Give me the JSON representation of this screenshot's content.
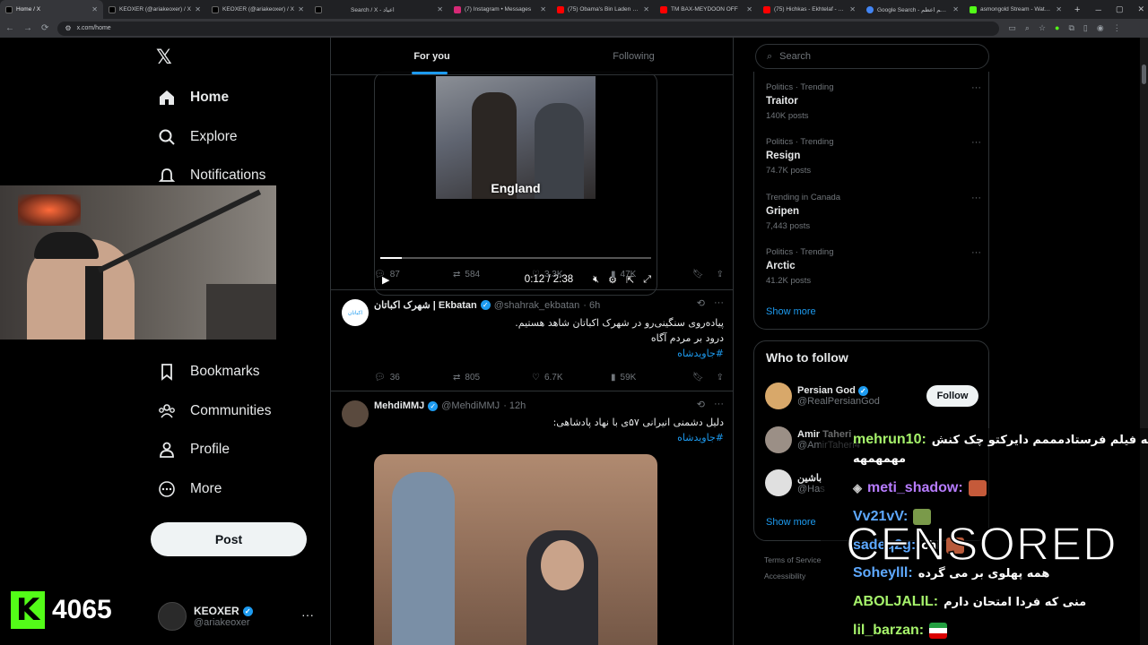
{
  "browser": {
    "tabs": [
      {
        "title": "Home / X",
        "active": true,
        "color": "#000000"
      },
      {
        "title": "KEOXER (@ariakeoxer) / X",
        "color": "#000000"
      },
      {
        "title": "KEOXER (@ariakeoxer) / X",
        "color": "#000000"
      },
      {
        "title": "",
        "color": "#000000"
      },
      {
        "title": "Search / X - اعیاد",
        "color": "#000000"
      },
      {
        "title": "(7) Instagram • Messages",
        "color": "#d62976"
      },
      {
        "title": "(75) Obama's Bin Laden & Tru",
        "color": "#ff0000"
      },
      {
        "title": "TM BAX-MEYDOON OFF",
        "color": "#ff0000"
      },
      {
        "title": "(75) Hichkas - Ekhtelaf - YouT",
        "color": "#ff0000"
      },
      {
        "title": "Google Search - کمکم اعظم",
        "color": "#4285f4"
      },
      {
        "title": "asmongold Stream - Watch Li",
        "color": "#53fc18"
      }
    ],
    "url": "x.com/home"
  },
  "nav": {
    "home": "Home",
    "explore": "Explore",
    "notifications": "Notifications",
    "bookmarks": "Bookmarks",
    "communities": "Communities",
    "profile": "Profile",
    "more": "More",
    "post": "Post"
  },
  "account": {
    "name": "KEOXER",
    "handle": "@ariakeoxer"
  },
  "timeline": {
    "tab_for_you": "For you",
    "tab_following": "Following",
    "video1": {
      "caption": "England",
      "time": "0:12 / 2:38",
      "progress": 0.08
    },
    "stats1": {
      "replies": "87",
      "reposts": "584",
      "likes": "3.3K",
      "views": "47K"
    },
    "tweet2": {
      "name": "شهرک اکباتان | Ekbatan",
      "handle": "@shahrak_ekbatan",
      "time": "· 6h",
      "line1": "پیاده‌روی سنگینی‌رو در شهرک اکباتان شاهد هستیم.",
      "line2": "درود بر مردم آگاه",
      "tag": "#جاویدشاه",
      "avatar_text": "اکباتان",
      "stats": {
        "replies": "36",
        "reposts": "805",
        "likes": "6.7K",
        "views": "59K"
      }
    },
    "tweet3": {
      "name": "MehdiMMJ",
      "handle": "@MehdiMMJ",
      "time": "· 12h",
      "line1": "دلیل دشمنی انیرانی ۵۷ی با نهاد پادشاهی:",
      "tag": "#جاویدشاه"
    }
  },
  "right": {
    "search_placeholder": "Search",
    "trends": [
      {
        "cat": "Politics · Trending",
        "name": "Traitor",
        "count": "140K posts"
      },
      {
        "cat": "Politics · Trending",
        "name": "Resign",
        "count": "74.7K posts"
      },
      {
        "cat": "Trending in Canada",
        "name": "Gripen",
        "count": "7,443 posts"
      },
      {
        "cat": "Politics · Trending",
        "name": "Arctic",
        "count": "41.2K posts"
      }
    ],
    "show_more": "Show more",
    "who_to_follow": "Who to follow",
    "follow": [
      {
        "name": "Persian God",
        "handle": "@RealPersianGod",
        "btn": "Follow"
      },
      {
        "name": "Amir Taheri",
        "handle": "@AmirTaheri4"
      },
      {
        "name": "باشین",
        "handle": "@Has"
      }
    ],
    "show_more2": "Show more",
    "footer1": "Terms of Service",
    "footer2": "Accessibility"
  },
  "stream": {
    "kick_count": "4065",
    "kick_letter": "K",
    "censored": "CENSORED",
    "chat": [
      {
        "user": "mehrun10:",
        "text": "اریا یه فیلم فرستادمممم دایرکتو چک کنش",
        "color": "#a6f36b"
      },
      {
        "user": "",
        "text": "مهمهمهه",
        "color": "#ffffff"
      },
      {
        "user": "meti_shadow:",
        "text": "",
        "color": "#b77cff"
      },
      {
        "user": "Vv21vV:",
        "text": "",
        "color": "#5ea9ff"
      },
      {
        "user": "sadeq2g:",
        "text": "chi",
        "color": "#5ea9ff"
      },
      {
        "user": "Soheylll:",
        "text": "همه پهلوی بر می گرده",
        "color": "#5ea9ff"
      },
      {
        "user": "ABOLJALIL:",
        "text": "منی که فردا امتحان دارم",
        "color": "#a6f36b"
      },
      {
        "user": "lil_barzan:",
        "text": "",
        "color": "#a6f36b"
      }
    ]
  }
}
